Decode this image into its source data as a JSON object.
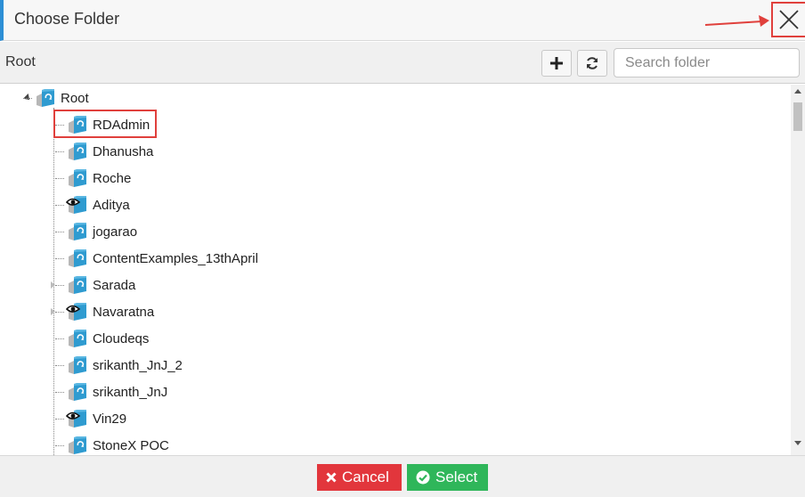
{
  "dialog": {
    "title": "Choose Folder"
  },
  "toolbar": {
    "breadcrumb": "Root",
    "search_placeholder": "Search folder"
  },
  "tree": {
    "root_label": "Root",
    "items": [
      {
        "label": "RDAdmin",
        "icon": "folder-refresh-icon",
        "has_children": false
      },
      {
        "label": "Dhanusha",
        "icon": "folder-refresh-icon",
        "has_children": false
      },
      {
        "label": "Roche",
        "icon": "folder-refresh-icon",
        "has_children": false
      },
      {
        "label": "Aditya",
        "icon": "folder-eye-icon",
        "has_children": false
      },
      {
        "label": "jogarao",
        "icon": "folder-refresh-icon",
        "has_children": false
      },
      {
        "label": "ContentExamples_13thApril",
        "icon": "folder-refresh-icon",
        "has_children": false
      },
      {
        "label": "Sarada",
        "icon": "folder-refresh-icon",
        "has_children": true
      },
      {
        "label": "Navaratna",
        "icon": "folder-eye-icon",
        "has_children": true
      },
      {
        "label": "Cloudeqs",
        "icon": "folder-refresh-icon",
        "has_children": false
      },
      {
        "label": "srikanth_JnJ_2",
        "icon": "folder-refresh-icon",
        "has_children": false
      },
      {
        "label": "srikanth_JnJ",
        "icon": "folder-refresh-icon",
        "has_children": false
      },
      {
        "label": "Vin29",
        "icon": "folder-eye-icon",
        "has_children": false
      },
      {
        "label": "StoneX POC",
        "icon": "folder-refresh-icon",
        "has_children": false
      }
    ]
  },
  "footer": {
    "cancel_label": "Cancel",
    "select_label": "Select"
  },
  "colors": {
    "accent": "#2d8fd5",
    "cancel": "#e2363c",
    "select": "#2fb65a",
    "annotation": "#e0403c"
  }
}
